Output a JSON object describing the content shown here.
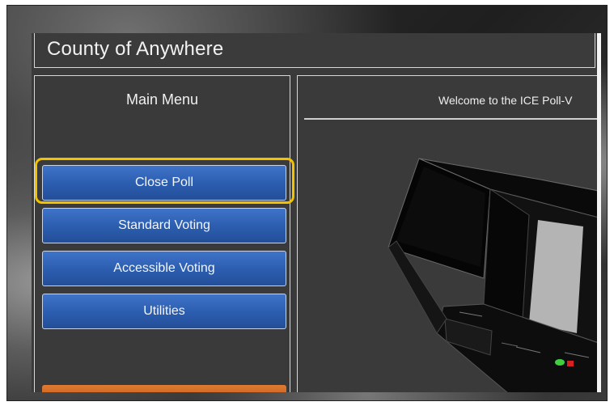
{
  "header": {
    "title": "County of Anywhere"
  },
  "main_menu": {
    "title": "Main Menu",
    "buttons": [
      {
        "label": "Close Poll",
        "highlighted": true
      },
      {
        "label": "Standard Voting"
      },
      {
        "label": "Accessible Voting"
      },
      {
        "label": "Utilities"
      }
    ]
  },
  "welcome_panel": {
    "text": "Welcome to the ICE Poll-V"
  },
  "colors": {
    "button_blue": "#2b5cae",
    "highlight_yellow": "#f2c200",
    "orange_button": "#e07b32",
    "screen_bg": "#3a3a3a"
  },
  "icons": [
    "voting-machine-illustration"
  ]
}
